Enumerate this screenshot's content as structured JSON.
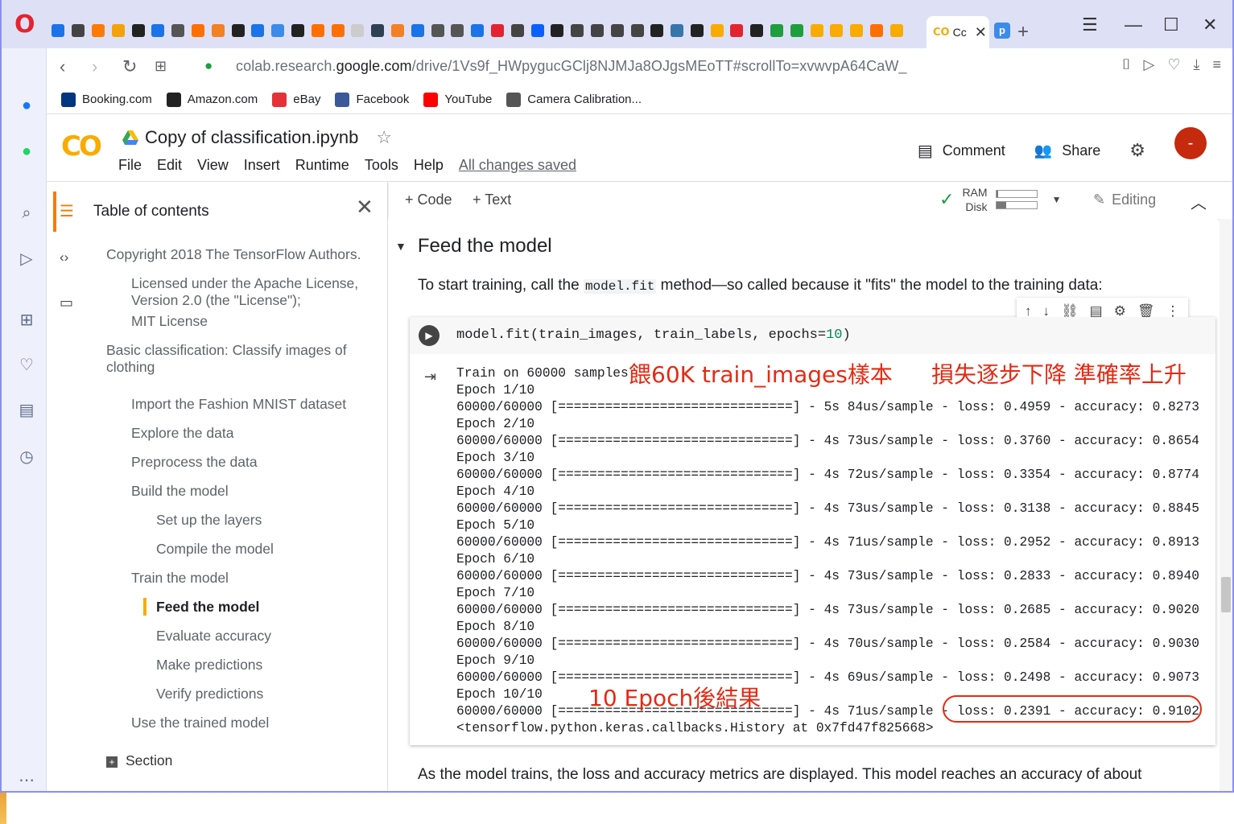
{
  "browser": {
    "active_tab_title": "Cc",
    "url_prefix": "colab.research.",
    "url_host": "google.com",
    "url_path": "/drive/1Vs9f_HWpygucGClj8NJMJa8OJgsMEoTT#scrollTo=xvwvpA64CaW_",
    "bookmarks": [
      {
        "label": "Booking.com",
        "icon": "booking-icon",
        "color": "#003580"
      },
      {
        "label": "Amazon.com",
        "icon": "amazon-icon",
        "color": "#222222"
      },
      {
        "label": "eBay",
        "icon": "ebay-icon",
        "color": "#e53238"
      },
      {
        "label": "Facebook",
        "icon": "facebook-icon",
        "color": "#3b5998"
      },
      {
        "label": "YouTube",
        "icon": "youtube-icon",
        "color": "#ff0000"
      },
      {
        "label": "Camera Calibration...",
        "icon": "page-icon",
        "color": "#555555"
      }
    ]
  },
  "colab": {
    "notebook_title": "Copy of classification.ipynb",
    "menus": [
      "File",
      "Edit",
      "View",
      "Insert",
      "Runtime",
      "Tools",
      "Help"
    ],
    "saved_status": "All changes saved",
    "comment_label": "Comment",
    "share_label": "Share",
    "avatar_text": "-",
    "add_code": "+ Code",
    "add_text": "+ Text",
    "ram_label": "RAM",
    "disk_label": "Disk",
    "ram_usage": 0.05,
    "disk_usage": 0.25,
    "editing_label": "Editing"
  },
  "toc": {
    "title": "Table of contents",
    "items": [
      {
        "label": "Copyright 2018 The TensorFlow Authors.",
        "level": 0
      },
      {
        "label": "Licensed under the Apache License, Version 2.0 (the \"License\");",
        "level": 1
      },
      {
        "label": "MIT License",
        "level": 1
      },
      {
        "label": "Basic classification: Classify images of clothing",
        "level": 0
      },
      {
        "label": "Import the Fashion MNIST dataset",
        "level": 1
      },
      {
        "label": "Explore the data",
        "level": 1
      },
      {
        "label": "Preprocess the data",
        "level": 1
      },
      {
        "label": "Build the model",
        "level": 1
      },
      {
        "label": "Set up the layers",
        "level": 2
      },
      {
        "label": "Compile the model",
        "level": 2
      },
      {
        "label": "Train the model",
        "level": 1
      },
      {
        "label": "Feed the model",
        "level": 2,
        "active": true
      },
      {
        "label": "Evaluate accuracy",
        "level": 2
      },
      {
        "label": "Make predictions",
        "level": 2
      },
      {
        "label": "Verify predictions",
        "level": 2
      },
      {
        "label": "Use the trained model",
        "level": 1
      }
    ],
    "section_label": "Section"
  },
  "content": {
    "heading": "Feed the model",
    "intro_before": "To start training, call the ",
    "intro_code": "model.fit",
    "intro_after": " method—so called because it \"fits\" the model to the training data:",
    "code_before": "model.fit(train_images, train_labels, epochs=",
    "code_num": "10",
    "code_after": ")",
    "output_header": "Train on 60000 samples",
    "epochs": [
      {
        "epoch": "Epoch 1/10",
        "progress": "60000/60000",
        "bar": "[==============================]",
        "time": "5s 84us/sample",
        "loss": "0.4959",
        "accuracy": "0.8273"
      },
      {
        "epoch": "Epoch 2/10",
        "progress": "60000/60000",
        "bar": "[==============================]",
        "time": "4s 73us/sample",
        "loss": "0.3760",
        "accuracy": "0.8654"
      },
      {
        "epoch": "Epoch 3/10",
        "progress": "60000/60000",
        "bar": "[==============================]",
        "time": "4s 72us/sample",
        "loss": "0.3354",
        "accuracy": "0.8774"
      },
      {
        "epoch": "Epoch 4/10",
        "progress": "60000/60000",
        "bar": "[==============================]",
        "time": "4s 73us/sample",
        "loss": "0.3138",
        "accuracy": "0.8845"
      },
      {
        "epoch": "Epoch 5/10",
        "progress": "60000/60000",
        "bar": "[==============================]",
        "time": "4s 71us/sample",
        "loss": "0.2952",
        "accuracy": "0.8913"
      },
      {
        "epoch": "Epoch 6/10",
        "progress": "60000/60000",
        "bar": "[==============================]",
        "time": "4s 73us/sample",
        "loss": "0.2833",
        "accuracy": "0.8940"
      },
      {
        "epoch": "Epoch 7/10",
        "progress": "60000/60000",
        "bar": "[==============================]",
        "time": "4s 73us/sample",
        "loss": "0.2685",
        "accuracy": "0.9020"
      },
      {
        "epoch": "Epoch 8/10",
        "progress": "60000/60000",
        "bar": "[==============================]",
        "time": "4s 70us/sample",
        "loss": "0.2584",
        "accuracy": "0.9030"
      },
      {
        "epoch": "Epoch 9/10",
        "progress": "60000/60000",
        "bar": "[==============================]",
        "time": "4s 69us/sample",
        "loss": "0.2498",
        "accuracy": "0.9073"
      },
      {
        "epoch": "Epoch 10/10",
        "progress": "60000/60000",
        "bar": "[==============================]",
        "time": "4s 71us/sample",
        "loss": "0.2391",
        "accuracy": "0.9102"
      }
    ],
    "output_footer": "<tensorflow.python.keras.callbacks.History at 0x7fd47f825668>",
    "annotation_samples": "餵60K train_images樣本",
    "annotation_trend": "損失逐步下降 準確率上升",
    "annotation_result": "10 Epoch後結果",
    "annotation_color": "#e52a13",
    "bottom_text": "As the model trains, the loss and accuracy metrics are displayed. This model reaches an accuracy of about"
  }
}
